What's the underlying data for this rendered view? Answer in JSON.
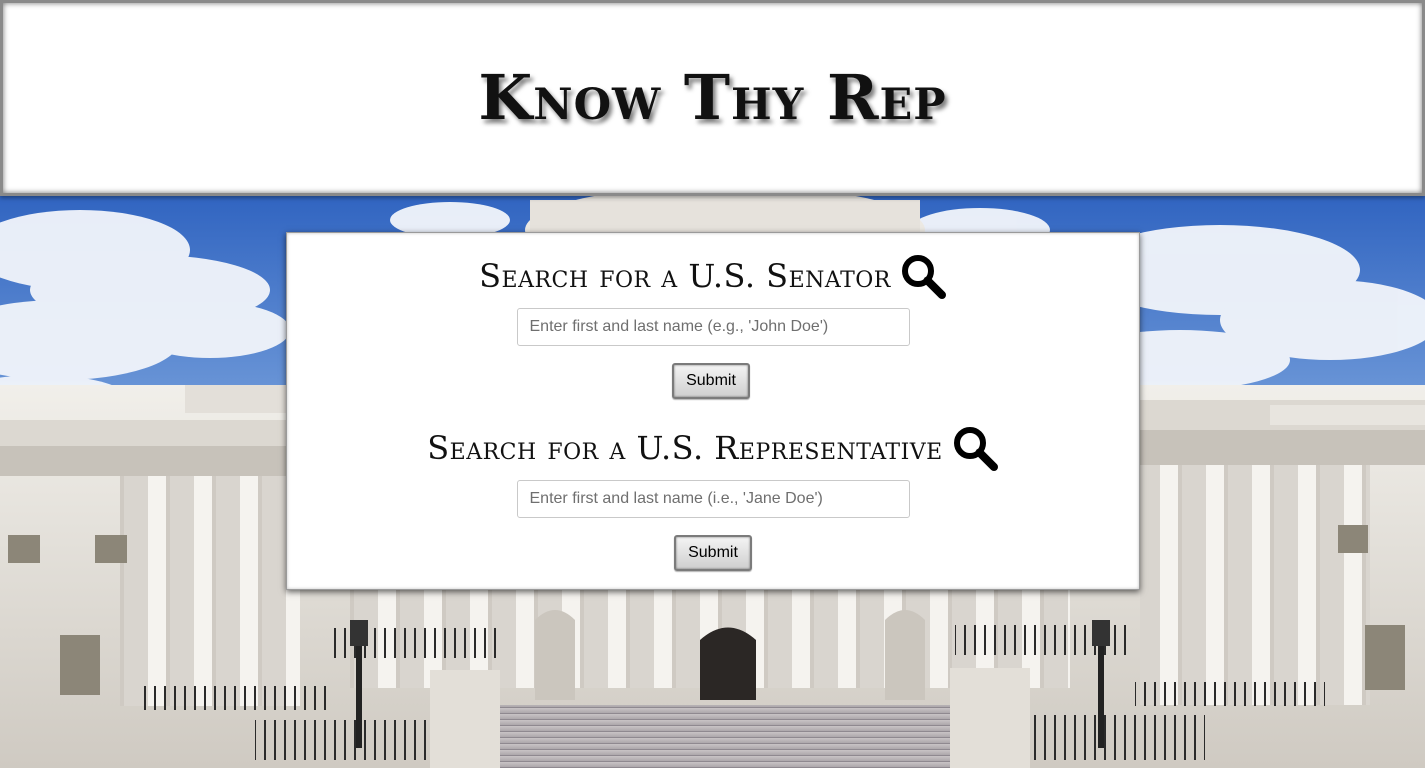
{
  "header": {
    "title": "Know Thy Rep"
  },
  "senator": {
    "heading": "Search for a U.S. Senator",
    "icon": "search-icon",
    "input_value": "",
    "input_placeholder": "Enter first and last name (e.g., 'John Doe')",
    "submit_label": "Submit"
  },
  "representative": {
    "heading": "Search for a U.S. Representative",
    "icon": "search-icon",
    "input_value": "",
    "input_placeholder": "Enter first and last name (i.e., 'Jane Doe')",
    "submit_label": "Submit"
  },
  "colors": {
    "sky": "#3f6fc4",
    "marble": "#e9e6e0",
    "panel": "#ffffff",
    "text": "#111111"
  }
}
